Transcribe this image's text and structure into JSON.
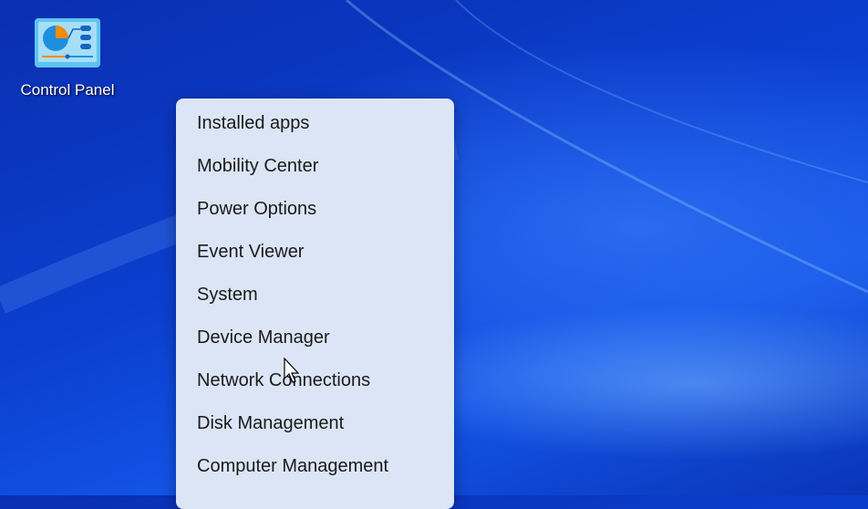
{
  "desktop": {
    "icons": [
      {
        "label": "Control Panel",
        "icon": "control-panel-icon"
      }
    ]
  },
  "context_menu": {
    "items": [
      "Installed apps",
      "Mobility Center",
      "Power Options",
      "Event Viewer",
      "System",
      "Device Manager",
      "Network Connections",
      "Disk Management",
      "Computer Management"
    ]
  }
}
